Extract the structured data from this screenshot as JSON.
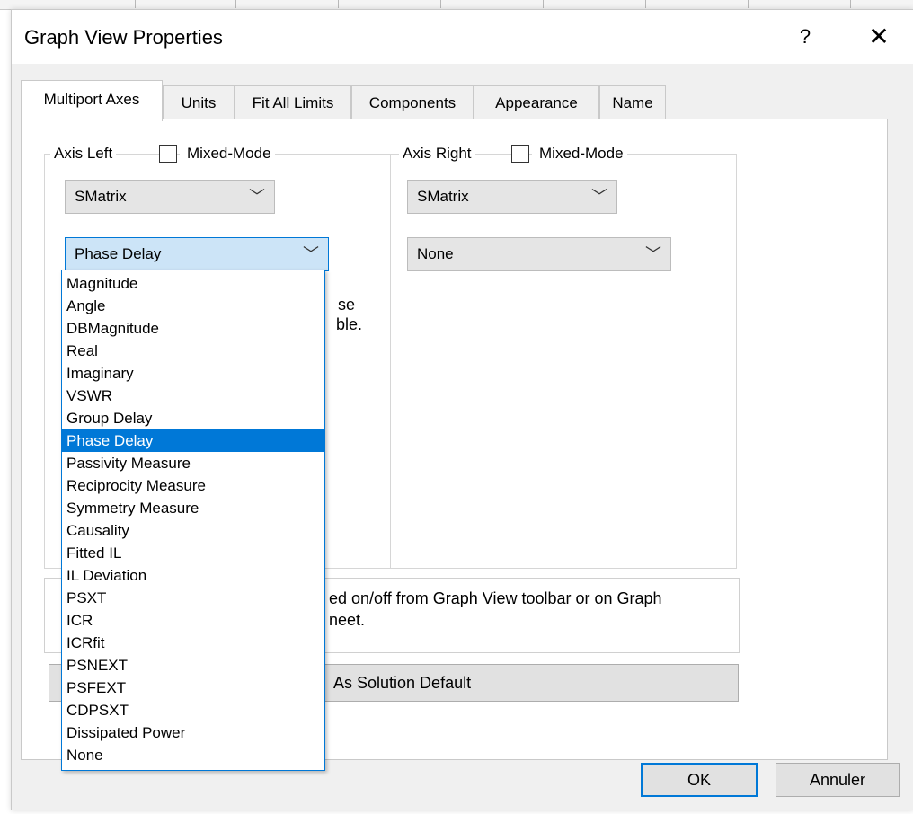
{
  "dialog": {
    "title": "Graph View Properties",
    "help_label": "?",
    "close_label": "✕"
  },
  "tabs": [
    {
      "label": "Multiport Axes",
      "active": true
    },
    {
      "label": "Units"
    },
    {
      "label": "Fit All Limits"
    },
    {
      "label": "Components"
    },
    {
      "label": "Appearance"
    },
    {
      "label": "Name"
    }
  ],
  "axis_left": {
    "legend": "Axis Left",
    "mixed_mode_label": "Mixed-Mode",
    "matrix_value": "SMatrix",
    "quantity_value": "Phase Delay",
    "hint_fragment_1": "se",
    "hint_fragment_2": "ble."
  },
  "axis_right": {
    "legend": "Axis Right",
    "mixed_mode_label": "Mixed-Mode",
    "matrix_value": "SMatrix",
    "quantity_value": "None"
  },
  "info": {
    "line1": "ed on/off from Graph View toolbar or on Graph",
    "line2": "neet."
  },
  "solution_button": "As Solution Default",
  "dropdown_options": [
    "Magnitude",
    "Angle",
    "DBMagnitude",
    "Real",
    "Imaginary",
    "VSWR",
    "Group Delay",
    "Phase Delay",
    "Passivity Measure",
    "Reciprocity Measure",
    "Symmetry Measure",
    "Causality",
    "Fitted IL",
    "IL Deviation",
    "PSXT",
    "ICR",
    "ICRfit",
    "PSNEXT",
    "PSFEXT",
    "CDPSXT",
    "Dissipated Power",
    "None"
  ],
  "dropdown_selected": "Phase Delay",
  "buttons": {
    "ok": "OK",
    "cancel": "Annuler"
  },
  "icons": {
    "chevron": "chevron-down-icon",
    "close": "close-icon",
    "help": "help-icon"
  },
  "colors": {
    "accent": "#0078d7",
    "dialog_bg": "#f0f0f0",
    "focused_combo": "#cce4f7"
  }
}
